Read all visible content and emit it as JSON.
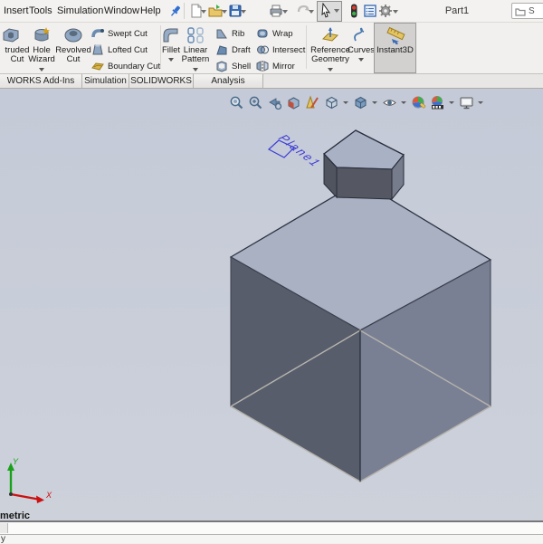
{
  "titlebar": {
    "menus": [
      "Insert",
      "Tools",
      "Simulation",
      "Window",
      "Help"
    ],
    "title": "Part1",
    "search_text": "S"
  },
  "ribbon": {
    "large": [
      {
        "line1": "truded",
        "line2": "Cut"
      },
      {
        "line1": "Hole",
        "line2": "Wizard"
      },
      {
        "line1": "Revolved",
        "line2": "Cut"
      },
      {
        "line1": "Fillet",
        "line2": ""
      },
      {
        "line1": "Linear",
        "line2": "Pattern"
      },
      {
        "line1": "Reference",
        "line2": "Geometry"
      },
      {
        "line1": "Curves",
        "line2": ""
      },
      {
        "line1": "Instant3D",
        "line2": ""
      }
    ],
    "stack1": [
      "Swept Cut",
      "Lofted Cut",
      "Boundary Cut"
    ],
    "stack2": [
      "Rib",
      "Draft",
      "Shell"
    ],
    "stack3": [
      "Wrap",
      "Intersect",
      "Mirror"
    ]
  },
  "tabs": [
    "WORKS Add-Ins",
    "Simulation",
    "SOLIDWORKS MBD",
    "Analysis Preparation"
  ],
  "viewport": {
    "plane_label": "Plane1",
    "orientation_label": "metric",
    "axis_x_label": "X",
    "axis_y_label": "Y",
    "status_fragment": "y"
  },
  "colors": {
    "viewport_top": "#c4cad7",
    "viewport_bottom": "#cdd1da",
    "cube_top": "#a9b1c3",
    "cube_left": "#575d6b",
    "cube_right": "#7a8093",
    "hex_top": "#a9b1c4",
    "hex_left": "#50545f",
    "hex_front": "#555862",
    "hex_right": "#767c8b",
    "edge_dark": "#2c3240",
    "edge_light": "#b7b4ae",
    "plane_blue": "#3d3dd6",
    "axis_green": "#1aa11a",
    "axis_red": "#cc1111",
    "pressed_button": "#d2d1d0"
  }
}
